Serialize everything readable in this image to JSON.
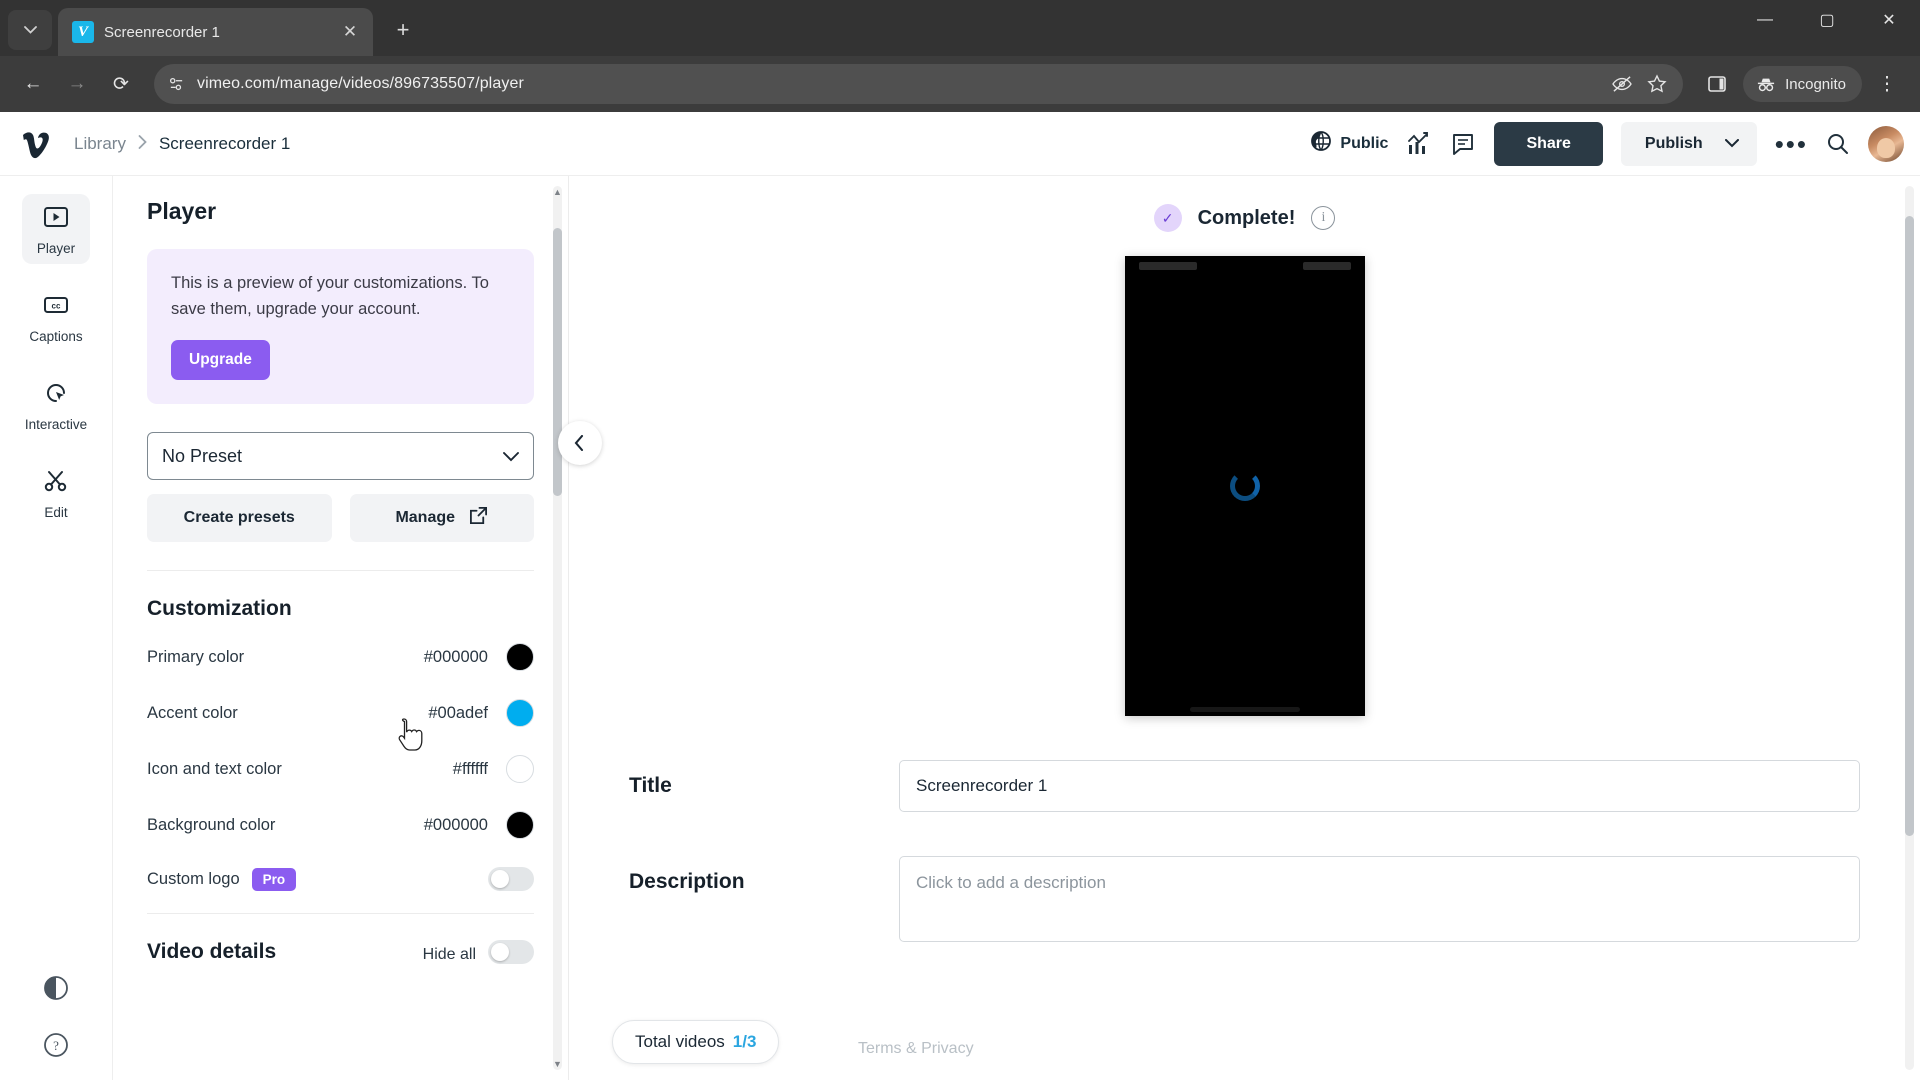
{
  "browser": {
    "tab": {
      "title": "Screenrecorder 1",
      "favicon": "vimeo-favicon",
      "close_label": "✕"
    },
    "new_tab_label": "+",
    "window_controls": {
      "minimize": "—",
      "maximize": "▢",
      "close": "✕"
    },
    "nav": {
      "back": "←",
      "forward": "→",
      "reload": "⟳"
    },
    "omnibox": {
      "url": "vimeo.com/manage/videos/896735507/player",
      "site_info_icon": "page-info-icon",
      "icons": [
        "eye-off-icon",
        "star-icon",
        "side-panel-icon"
      ]
    },
    "incognito_label": "Incognito",
    "menu_label": "⋮"
  },
  "header": {
    "logo": "vimeo-logo",
    "breadcrumb": {
      "root": "Library",
      "separator": "›",
      "current": "Screenrecorder 1"
    },
    "privacy_label": "Public",
    "stats_icon": "analytics-icon",
    "comments_icon": "comment-icon",
    "share_label": "Share",
    "publish_label": "Publish",
    "more_label": "•••",
    "search_icon": "search-icon",
    "avatar": "user-avatar"
  },
  "rail": {
    "items": [
      {
        "label": "Player",
        "icon": "player-icon",
        "active": true
      },
      {
        "label": "Captions",
        "icon": "captions-icon",
        "active": false
      },
      {
        "label": "Interactive",
        "icon": "interactive-icon",
        "active": false
      },
      {
        "label": "Edit",
        "icon": "scissors-icon",
        "active": false
      }
    ],
    "bottom": [
      {
        "icon": "contrast-icon",
        "label": "Accessibility"
      },
      {
        "icon": "help-icon",
        "label": "Help"
      }
    ]
  },
  "panel": {
    "title": "Player",
    "upsell": {
      "text": "This is a preview of your customizations. To save them, upgrade your account.",
      "button": "Upgrade"
    },
    "preset": {
      "value": "No Preset",
      "chevron": "chevron-down-icon"
    },
    "create_presets_label": "Create presets",
    "manage_label": "Manage",
    "customization_title": "Customization",
    "colors": [
      {
        "label": "Primary color",
        "value": "#000000",
        "swatch": "#000000"
      },
      {
        "label": "Accent color",
        "value": "#00adef",
        "swatch": "#00adef"
      },
      {
        "label": "Icon and text color",
        "value": "#ffffff",
        "swatch": "#ffffff"
      },
      {
        "label": "Background color",
        "value": "#000000",
        "swatch": "#000000"
      }
    ],
    "custom_logo": {
      "label": "Custom logo",
      "badge": "Pro",
      "enabled": false
    },
    "video_details": {
      "title": "Video details",
      "hide_all_label": "Hide all"
    }
  },
  "main": {
    "status": {
      "text": "Complete!",
      "icon": "check-icon",
      "info_icon": "info-icon"
    },
    "collapse_icon": "chevron-left-icon",
    "title_field": {
      "label": "Title",
      "value": "Screenrecorder 1"
    },
    "description_field": {
      "label": "Description",
      "placeholder": "Click to add a description",
      "value": ""
    },
    "total_videos": {
      "label": "Total videos",
      "count": "1/3"
    },
    "terms_label": "Terms & Privacy",
    "preview": {
      "state": "loading",
      "spinner_color": "#1062a8",
      "background": "#000000"
    }
  }
}
